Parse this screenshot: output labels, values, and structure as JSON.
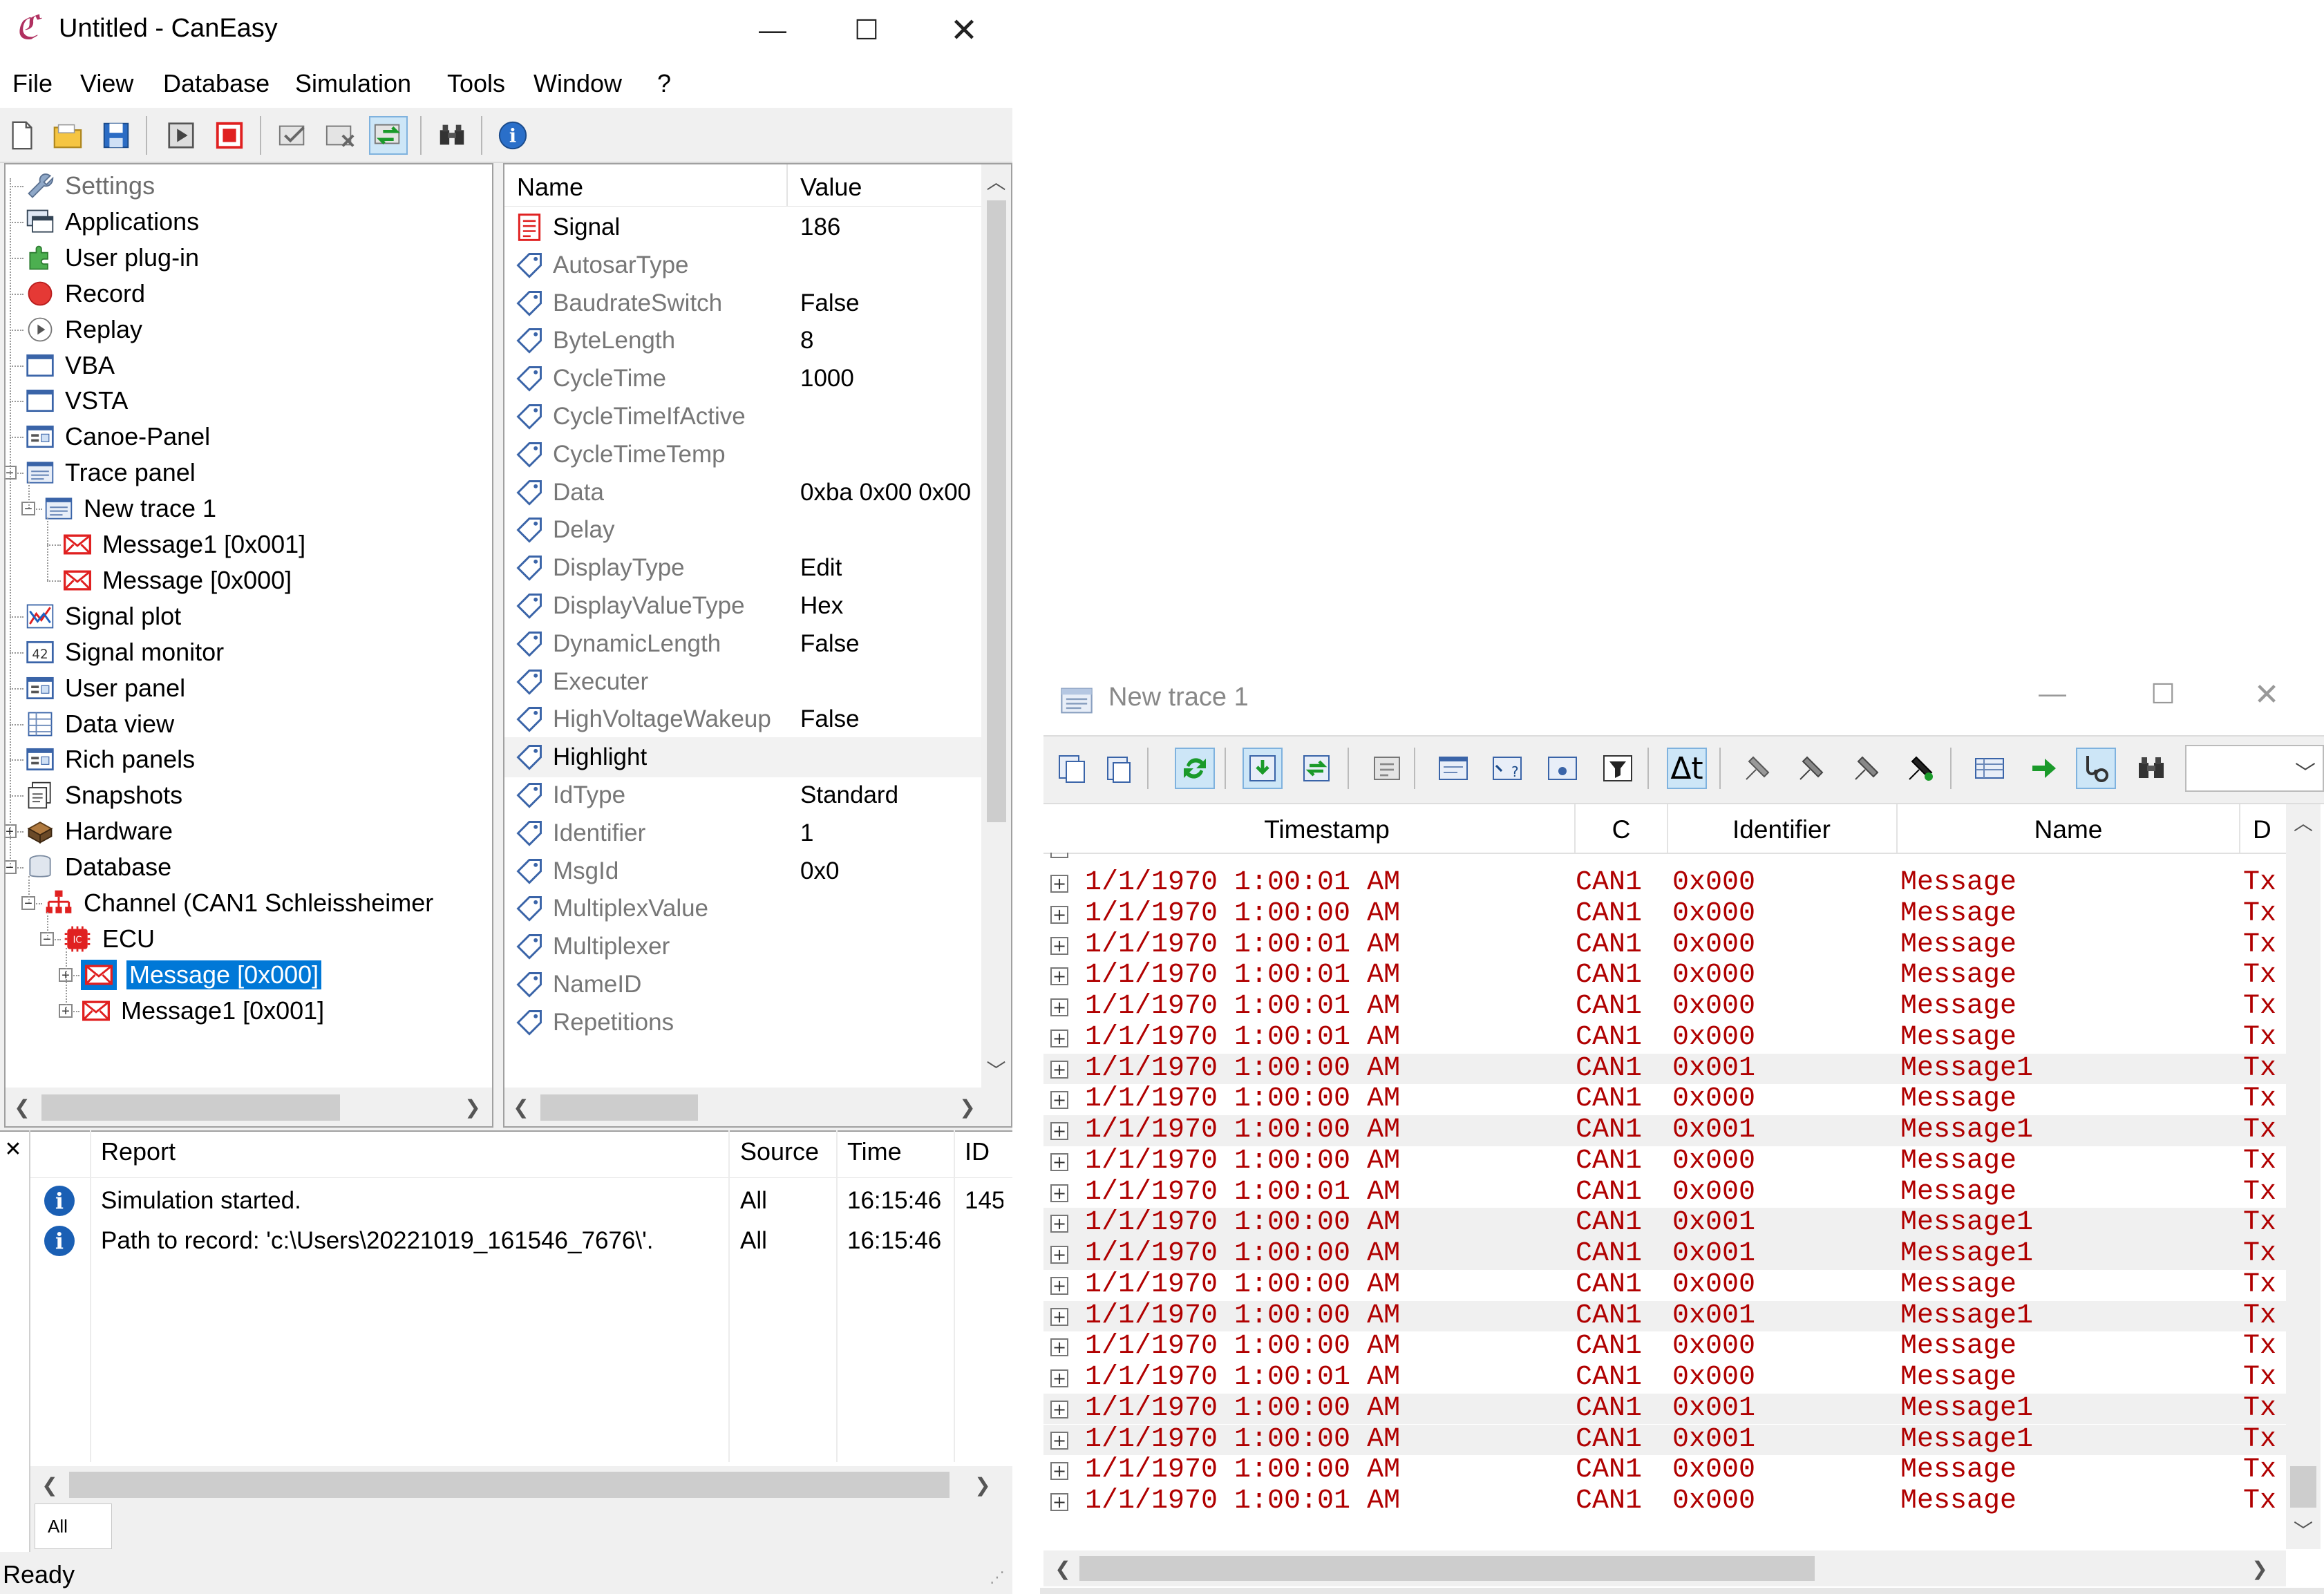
{
  "main_window": {
    "title": "Untitled - CanEasy",
    "menu": [
      "File",
      "View",
      "Database",
      "Simulation",
      "Tools",
      "Window",
      "?"
    ],
    "status": "Ready"
  },
  "tree": {
    "items": [
      {
        "label": "Settings",
        "icon": "wrench-icon"
      },
      {
        "label": "Applications",
        "icon": "applications-icon"
      },
      {
        "label": "User plug-in",
        "icon": "plugin-icon"
      },
      {
        "label": "Record",
        "icon": "record-icon"
      },
      {
        "label": "Replay",
        "icon": "replay-icon"
      },
      {
        "label": "VBA",
        "icon": "window-icon"
      },
      {
        "label": "VSTA",
        "icon": "window-icon"
      },
      {
        "label": "Canoe-Panel",
        "icon": "panel-icon"
      },
      {
        "label": "Trace panel",
        "icon": "trace-icon"
      },
      {
        "label": "New trace 1",
        "icon": "trace-icon"
      },
      {
        "label": "Message1 [0x001]",
        "icon": "message-icon"
      },
      {
        "label": "Message [0x000]",
        "icon": "message-icon"
      },
      {
        "label": "Signal plot",
        "icon": "signal-plot-icon"
      },
      {
        "label": "Signal monitor",
        "icon": "signal-monitor-icon"
      },
      {
        "label": "User panel",
        "icon": "panel-icon"
      },
      {
        "label": "Data view",
        "icon": "data-view-icon"
      },
      {
        "label": "Rich panels",
        "icon": "panel-icon"
      },
      {
        "label": "Snapshots",
        "icon": "snapshot-icon"
      },
      {
        "label": "Hardware",
        "icon": "hardware-icon"
      },
      {
        "label": "Database",
        "icon": "database-icon"
      },
      {
        "label": "Channel (CAN1 Schleissheimer",
        "icon": "channel-icon"
      },
      {
        "label": "ECU",
        "icon": "ecu-icon"
      },
      {
        "label": "Message [0x000]",
        "icon": "message-icon"
      },
      {
        "label": "Message1 [0x001]",
        "icon": "message-icon"
      }
    ]
  },
  "properties": {
    "header": {
      "name": "Name",
      "value": "Value"
    },
    "rows": [
      {
        "name": "Signal",
        "value": "186"
      },
      {
        "name": "AutosarType",
        "value": ""
      },
      {
        "name": "BaudrateSwitch",
        "value": "False"
      },
      {
        "name": "ByteLength",
        "value": "8"
      },
      {
        "name": "CycleTime",
        "value": "1000"
      },
      {
        "name": "CycleTimeIfActive",
        "value": ""
      },
      {
        "name": "CycleTimeTemp",
        "value": ""
      },
      {
        "name": "Data",
        "value": "0xba 0x00 0x00"
      },
      {
        "name": "Delay",
        "value": ""
      },
      {
        "name": "DisplayType",
        "value": "Edit"
      },
      {
        "name": "DisplayValueType",
        "value": "Hex"
      },
      {
        "name": "DynamicLength",
        "value": "False"
      },
      {
        "name": "Executer",
        "value": ""
      },
      {
        "name": "HighVoltageWakeup",
        "value": "False"
      },
      {
        "name": "Highlight",
        "value": ""
      },
      {
        "name": "IdType",
        "value": "Standard"
      },
      {
        "name": "Identifier",
        "value": "1"
      },
      {
        "name": "MsgId",
        "value": "0x0"
      },
      {
        "name": "MultiplexValue",
        "value": ""
      },
      {
        "name": "Multiplexer",
        "value": ""
      },
      {
        "name": "NameID",
        "value": ""
      },
      {
        "name": "Repetitions",
        "value": ""
      }
    ]
  },
  "report": {
    "columns": [
      "Report",
      "Source",
      "Time",
      "ID"
    ],
    "rows": [
      {
        "report": "Simulation started.",
        "source": "All",
        "time": "16:15:46",
        "id": "145"
      },
      {
        "report": "Path to record: 'c:\\Users\\20221019_161546_7676\\'.",
        "source": "All",
        "time": "16:15:46",
        "id": ""
      }
    ],
    "filter_tab": "All"
  },
  "trace_window": {
    "title": "New trace 1",
    "columns": [
      "Timestamp",
      "C",
      "Identifier",
      "Name",
      "D"
    ],
    "rows": [
      {
        "ts": "1/1/1970 1:00:01 AM",
        "ch": "CAN1",
        "id": "0x000",
        "name": "Message",
        "dir": "Tx"
      },
      {
        "ts": "1/1/1970 1:00:00 AM",
        "ch": "CAN1",
        "id": "0x000",
        "name": "Message",
        "dir": "Tx"
      },
      {
        "ts": "1/1/1970 1:00:01 AM",
        "ch": "CAN1",
        "id": "0x000",
        "name": "Message",
        "dir": "Tx"
      },
      {
        "ts": "1/1/1970 1:00:01 AM",
        "ch": "CAN1",
        "id": "0x000",
        "name": "Message",
        "dir": "Tx"
      },
      {
        "ts": "1/1/1970 1:00:01 AM",
        "ch": "CAN1",
        "id": "0x000",
        "name": "Message",
        "dir": "Tx"
      },
      {
        "ts": "1/1/1970 1:00:01 AM",
        "ch": "CAN1",
        "id": "0x000",
        "name": "Message",
        "dir": "Tx"
      },
      {
        "ts": "1/1/1970 1:00:00 AM",
        "ch": "CAN1",
        "id": "0x001",
        "name": "Message1",
        "dir": "Tx"
      },
      {
        "ts": "1/1/1970 1:00:00 AM",
        "ch": "CAN1",
        "id": "0x000",
        "name": "Message",
        "dir": "Tx"
      },
      {
        "ts": "1/1/1970 1:00:00 AM",
        "ch": "CAN1",
        "id": "0x001",
        "name": "Message1",
        "dir": "Tx"
      },
      {
        "ts": "1/1/1970 1:00:00 AM",
        "ch": "CAN1",
        "id": "0x000",
        "name": "Message",
        "dir": "Tx"
      },
      {
        "ts": "1/1/1970 1:00:01 AM",
        "ch": "CAN1",
        "id": "0x000",
        "name": "Message",
        "dir": "Tx"
      },
      {
        "ts": "1/1/1970 1:00:00 AM",
        "ch": "CAN1",
        "id": "0x001",
        "name": "Message1",
        "dir": "Tx"
      },
      {
        "ts": "1/1/1970 1:00:00 AM",
        "ch": "CAN1",
        "id": "0x001",
        "name": "Message1",
        "dir": "Tx"
      },
      {
        "ts": "1/1/1970 1:00:00 AM",
        "ch": "CAN1",
        "id": "0x000",
        "name": "Message",
        "dir": "Tx"
      },
      {
        "ts": "1/1/1970 1:00:00 AM",
        "ch": "CAN1",
        "id": "0x001",
        "name": "Message1",
        "dir": "Tx"
      },
      {
        "ts": "1/1/1970 1:00:00 AM",
        "ch": "CAN1",
        "id": "0x000",
        "name": "Message",
        "dir": "Tx"
      },
      {
        "ts": "1/1/1970 1:00:01 AM",
        "ch": "CAN1",
        "id": "0x000",
        "name": "Message",
        "dir": "Tx"
      },
      {
        "ts": "1/1/1970 1:00:00 AM",
        "ch": "CAN1",
        "id": "0x001",
        "name": "Message1",
        "dir": "Tx"
      },
      {
        "ts": "1/1/1970 1:00:00 AM",
        "ch": "CAN1",
        "id": "0x001",
        "name": "Message1",
        "dir": "Tx"
      },
      {
        "ts": "1/1/1970 1:00:00 AM",
        "ch": "CAN1",
        "id": "0x000",
        "name": "Message",
        "dir": "Tx"
      },
      {
        "ts": "1/1/1970 1:00:01 AM",
        "ch": "CAN1",
        "id": "0x000",
        "name": "Message",
        "dir": "Tx"
      }
    ],
    "alt_rows": [
      6,
      8,
      11,
      12,
      14,
      17,
      18
    ]
  },
  "colors": {
    "selection": "#0078d7",
    "trace_text": "#b00000",
    "info": "#1a5fb4"
  }
}
